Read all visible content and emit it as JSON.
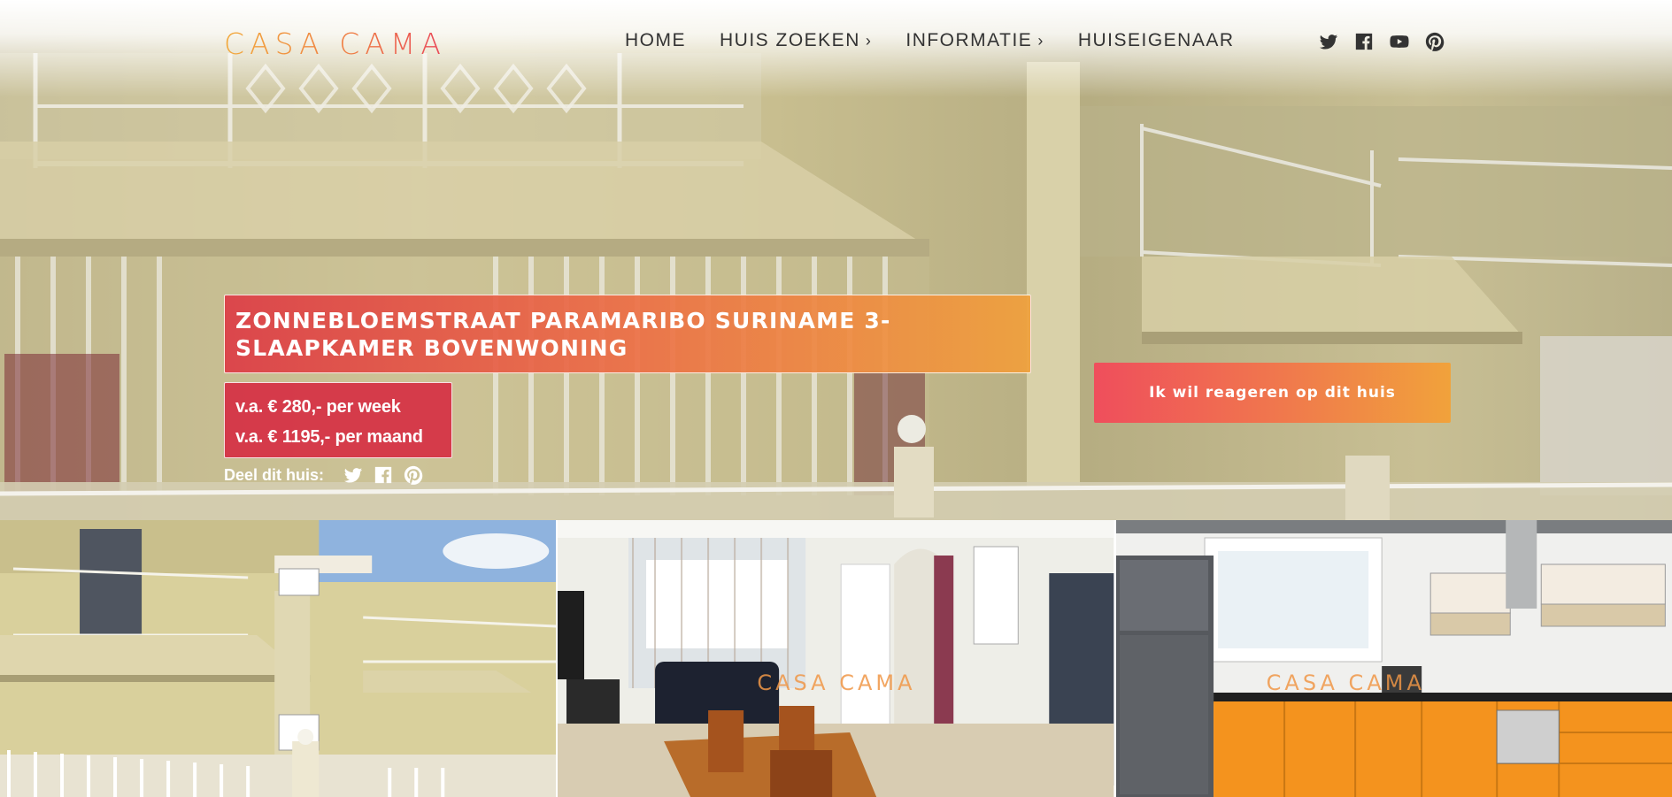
{
  "brand": {
    "logo_text": "CASA CAMA",
    "accent_orange": "#f2a93b",
    "accent_red": "#e9475a"
  },
  "nav": {
    "items": [
      {
        "label": "HOME",
        "has_submenu": false
      },
      {
        "label": "HUIS ZOEKEN",
        "has_submenu": true
      },
      {
        "label": "INFORMATIE",
        "has_submenu": true
      },
      {
        "label": "HUISEIGENAAR",
        "has_submenu": false
      }
    ],
    "submenu_glyph": "›",
    "social_icons": [
      "twitter-icon",
      "facebook-icon",
      "youtube-icon",
      "pinterest-icon"
    ]
  },
  "listing": {
    "title": "ZONNEBLOEMSTRAAT PARAMARIBO SURINAME 3-SLAAPKAMER BOVENWONING",
    "price_week": "v.a. € 280,- per week",
    "price_month": "v.a. € 1195,- per maand",
    "share_label": "Deel dit huis:",
    "share_icons": [
      "twitter-icon",
      "facebook-icon",
      "pinterest-icon"
    ],
    "cta_label": "Ik wil reageren op dit huis"
  },
  "gallery": {
    "photos": [
      {
        "subject": "exterior",
        "watermark": ""
      },
      {
        "subject": "living-room",
        "watermark": "CASA CAMA"
      },
      {
        "subject": "kitchen",
        "watermark": "CASA CAMA"
      }
    ]
  }
}
